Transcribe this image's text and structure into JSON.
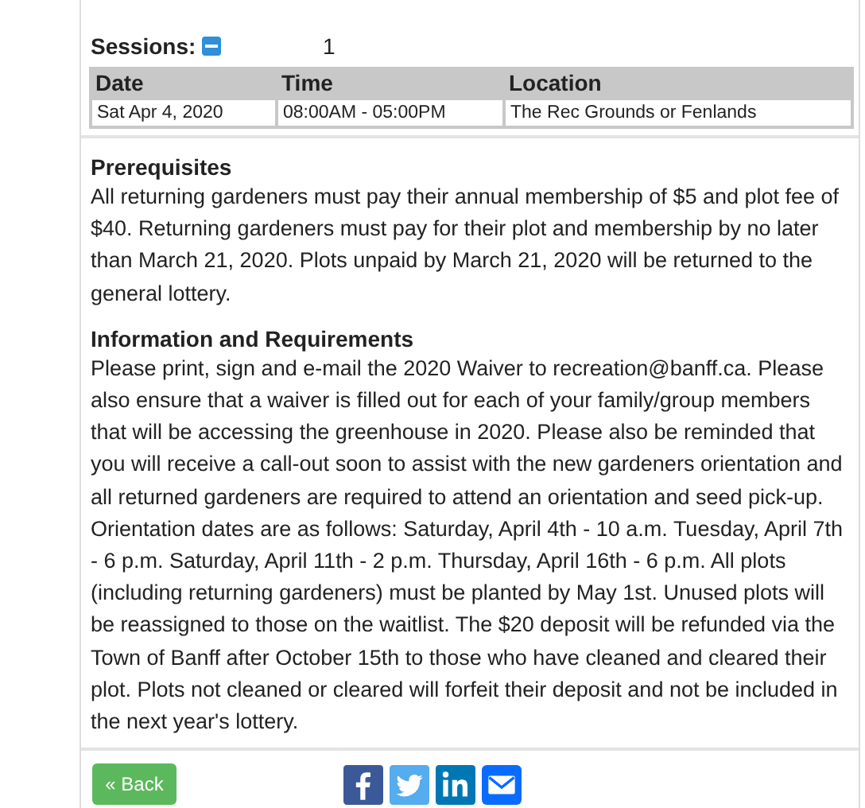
{
  "sessions": {
    "label": "Sessions:",
    "count": "1",
    "expanded": true
  },
  "table": {
    "columns": [
      "Date",
      "Time",
      "Location"
    ],
    "rows": [
      [
        "Sat  Apr 4, 2020",
        "08:00AM - 05:00PM",
        "The Rec Grounds or Fenlands"
      ]
    ]
  },
  "sections": [
    {
      "heading": "Prerequisites",
      "text": "All returning gardeners must pay their annual membership of $5 and plot fee of $40. Returning gardeners must pay for their plot and membership by no later than March 21, 2020. Plots unpaid by March 21, 2020 will be returned to the general lottery."
    },
    {
      "heading": "Information and Requirements",
      "text": "Please print, sign and e-mail the 2020 Waiver to recreation@banff.ca. Please also ensure that a waiver is filled out for each of your family/group members that will be accessing the greenhouse in 2020. Please also be reminded that you will receive a call-out soon to assist with the new gardeners orientation and all returned gardeners are required to attend an orientation and seed pick-up. Orientation dates are as follows: Saturday, April 4th - 10 a.m. Tuesday, April 7th - 6 p.m. Saturday, April 11th - 2 p.m. Thursday, April 16th - 6 p.m. All plots (including returning gardeners) must be planted by May 1st. Unused plots will be reassigned to those on the waitlist. The $20 deposit will be refunded via the Town of Banff after October 15th to those who have cleaned and cleared their plot. Plots not cleaned or cleared will forfeit their deposit and not be included in the next year's lottery."
    }
  ],
  "back_button": "« Back",
  "share": [
    {
      "kind": "facebook"
    },
    {
      "kind": "twitter"
    },
    {
      "kind": "linkedin"
    },
    {
      "kind": "email"
    }
  ]
}
